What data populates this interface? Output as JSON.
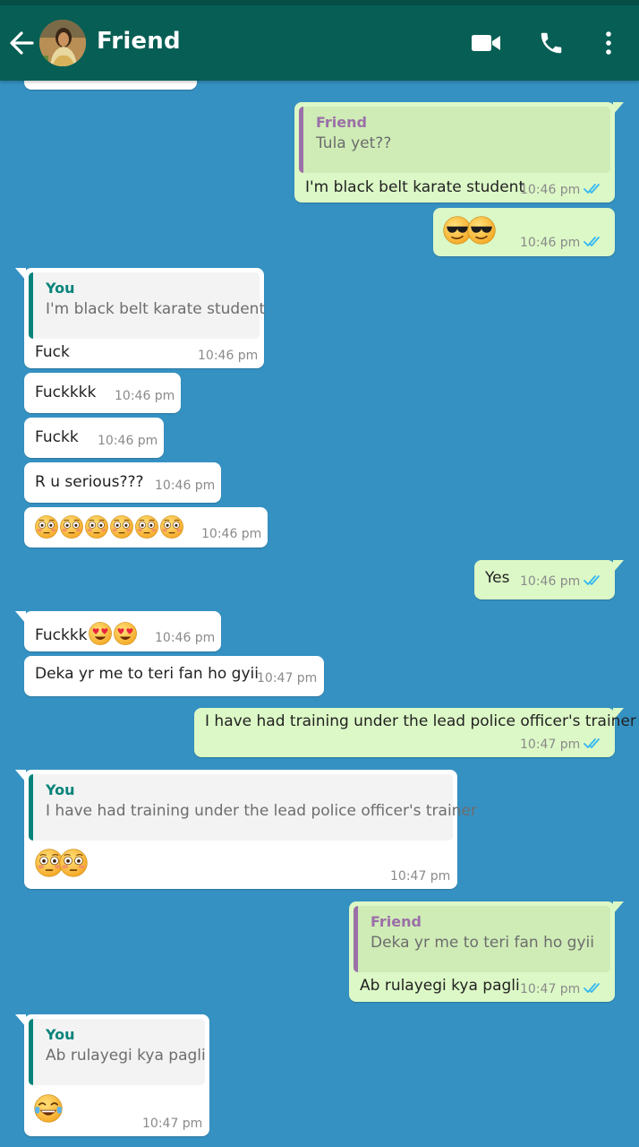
{
  "header": {
    "title": "Friend",
    "icons": [
      "back-arrow-icon",
      "avatar",
      "video-call-icon",
      "phone-icon",
      "more-vert-icon"
    ]
  },
  "colors": {
    "header": "#075e54",
    "background": "#3591c2",
    "outgoing": "#dcf8c6",
    "incoming": "#ffffff",
    "read_ticks": "#34b7f1"
  },
  "messages": [
    {
      "dir": "in",
      "partial": true
    },
    {
      "dir": "out",
      "quote": {
        "name": "Friend",
        "text": "Tula yet??"
      },
      "text": "I'm black belt karate student",
      "time": "10:46 pm",
      "read": true
    },
    {
      "dir": "out",
      "emojis": [
        "smiling-face-with-sunglasses",
        "smiling-face-with-sunglasses"
      ],
      "time": "10:46 pm",
      "read": true
    },
    {
      "dir": "in",
      "quote": {
        "name": "You",
        "text": "I'm black belt karate student"
      },
      "text": "Fuck",
      "time": "10:46 pm"
    },
    {
      "dir": "in",
      "text": "Fuckkkk",
      "time": "10:46 pm"
    },
    {
      "dir": "in",
      "text": "Fuckk",
      "time": "10:46 pm"
    },
    {
      "dir": "in",
      "text": "R u serious???",
      "time": "10:46 pm"
    },
    {
      "dir": "in",
      "emojis": [
        "flushed-face",
        "flushed-face",
        "flushed-face",
        "flushed-face",
        "flushed-face",
        "flushed-face"
      ],
      "time": "10:46 pm"
    },
    {
      "dir": "out",
      "text": "Yes",
      "time": "10:46 pm",
      "read": true
    },
    {
      "dir": "in",
      "text": "Fuckkk",
      "emojis_after": [
        "heart-eyes",
        "heart-eyes"
      ],
      "time": "10:46 pm"
    },
    {
      "dir": "in",
      "text": "Deka yr me to teri fan ho gyii",
      "time": "10:47 pm"
    },
    {
      "dir": "out",
      "text": "I have had training under the lead police officer's trainer",
      "time": "10:47 pm",
      "read": true
    },
    {
      "dir": "in",
      "quote": {
        "name": "You",
        "text": "I have had training under the lead police officer's trainer"
      },
      "emojis": [
        "flushed-face",
        "flushed-face"
      ],
      "time": "10:47 pm"
    },
    {
      "dir": "out",
      "quote": {
        "name": "Friend",
        "text": "Deka yr me to teri fan ho gyii"
      },
      "text": "Ab rulayegi kya pagli",
      "time": "10:47 pm",
      "read": true
    },
    {
      "dir": "in",
      "quote": {
        "name": "You",
        "text": "Ab rulayegi kya pagli"
      },
      "emojis": [
        "face-with-tears-of-joy"
      ],
      "time": "10:47 pm"
    }
  ]
}
